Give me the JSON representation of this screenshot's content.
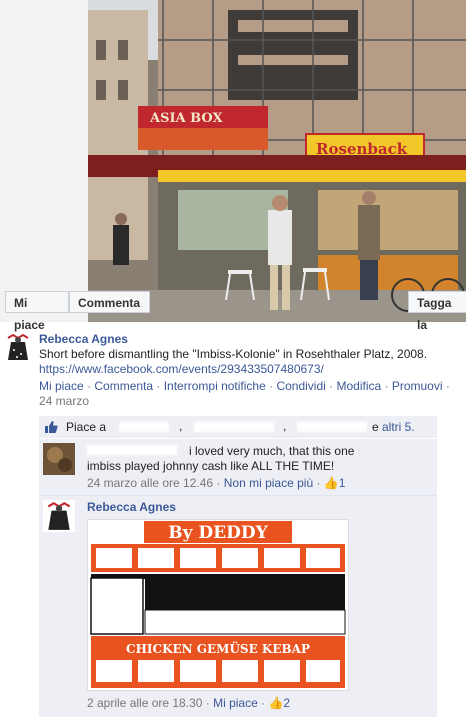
{
  "photo": {
    "sign_asia_box": "ASIA BOX",
    "sign_rosenback": "Rosenback"
  },
  "photo_buttons": {
    "like": "Mi piace",
    "comment": "Commenta",
    "tag": "Tagga la"
  },
  "post": {
    "author": "Rebecca Agnes",
    "text": "Short before dismantling the \"Imbiss-Kolonie\" in Rosehthaler Platz, 2008.",
    "link": "https://www.facebook.com/events/293433507480673/",
    "actions": [
      "Mi piace",
      "Commenta",
      "Interrompi notifiche",
      "Condividi",
      "Modifica",
      "Promuovi"
    ],
    "date": "24 marzo"
  },
  "likes": {
    "prefix": "Piace a",
    "sep1": ",",
    "sep2": ",",
    "and": "e",
    "others": "altri 5."
  },
  "comment1": {
    "text": "i loved very much, that this one imbiss played johnny cash like ALL THE TIME!",
    "date": "24 marzo alle ore 12.46",
    "unlike": "Non mi piace più",
    "like_count": "1"
  },
  "comment2": {
    "author": "Rebecca Agnes",
    "drawing_title": "By DEDDY",
    "drawing_caption": "CHICKEN GEMÜSE KEBAP",
    "date": "2 aprile alle ore 18.30",
    "like": "Mi piace",
    "like_count": "2"
  },
  "colors": {
    "link": "#3b5998",
    "comment_bg": "#edeff4",
    "drawing_orange": "#e8531f"
  }
}
